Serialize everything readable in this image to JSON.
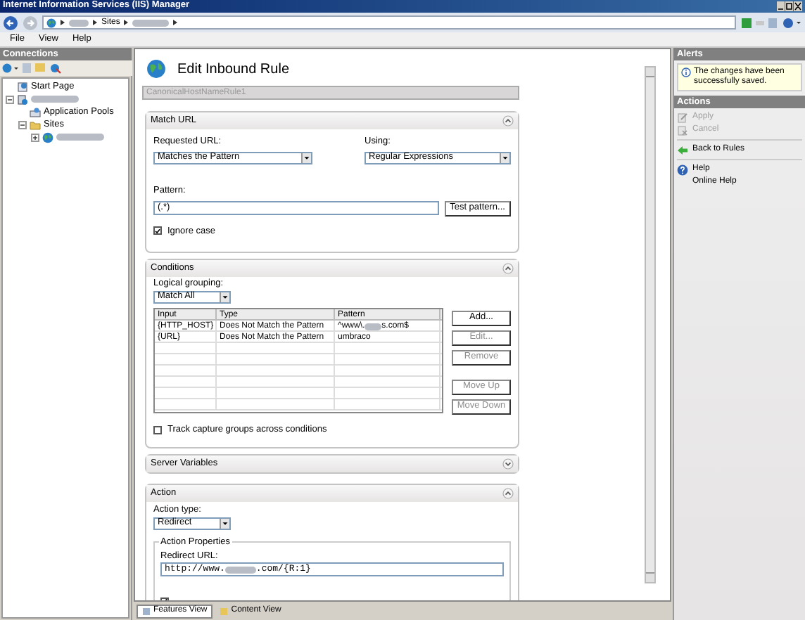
{
  "window": {
    "title": "Internet Information Services (IIS) Manager"
  },
  "breadcrumb": [
    {
      "redacted": true
    },
    {
      "redacted": false,
      "label": "Sites"
    },
    {
      "redacted": true
    }
  ],
  "menu": [
    "File",
    "View",
    "Help"
  ],
  "connections": {
    "title": "Connections",
    "tree": [
      {
        "kind": "page",
        "label": "Start Page",
        "redacted": false
      },
      {
        "kind": "server",
        "redacted": true,
        "expanded": true,
        "children": [
          {
            "kind": "pools",
            "label": "Application Pools",
            "redacted": false
          },
          {
            "kind": "folder",
            "label": "Sites",
            "redacted": false,
            "expanded": true,
            "children": [
              {
                "kind": "site",
                "redacted": true,
                "expanded": false
              }
            ]
          }
        ]
      }
    ]
  },
  "page": {
    "title": "Edit Inbound Rule",
    "name": "CanonicalHostNameRule1"
  },
  "match_url": {
    "title": "Match URL",
    "expanded": true,
    "requested_url_label": "Requested URL:",
    "requested_url": "Matches the Pattern",
    "using_label": "Using:",
    "using": "Regular Expressions",
    "pattern_label": "Pattern:",
    "pattern": "(.*)",
    "test_button": "Test pattern...",
    "ignore_case": {
      "label": "Ignore case",
      "checked": true
    }
  },
  "conditions": {
    "title": "Conditions",
    "expanded": true,
    "grouping_label": "Logical grouping:",
    "grouping": "Match All",
    "columns": [
      "Input",
      "Type",
      "Pattern"
    ],
    "rows": [
      {
        "input": "{HTTP_HOST}",
        "type": "Does Not Match the Pattern",
        "pattern": [
          "^www\\.",
          "s.com$"
        ]
      },
      {
        "input": "{URL}",
        "type": "Does Not Match the Pattern",
        "pattern": [
          "umbraco"
        ]
      }
    ],
    "button_groups": [
      [
        {
          "label": "Add...",
          "disabled": false
        },
        {
          "label": "Edit...",
          "disabled": true
        },
        {
          "label": "Remove",
          "disabled": true
        }
      ],
      [
        {
          "label": "Move Up",
          "disabled": true
        },
        {
          "label": "Move Down",
          "disabled": true
        }
      ]
    ],
    "track": {
      "label": "Track capture groups across conditions",
      "checked": false
    }
  },
  "server_variables": {
    "title": "Server Variables",
    "expanded": false
  },
  "action": {
    "title": "Action",
    "expanded": true,
    "action_type_label": "Action type:",
    "action_type": "Redirect",
    "properties_title": "Action Properties",
    "redirect_label": "Redirect URL:",
    "redirect_url": [
      "http://www.",
      ".com/{R:1}"
    ],
    "append": {
      "checked": true
    }
  },
  "view_tabs": [
    {
      "label": "Features View",
      "selected": true
    },
    {
      "label": "Content View",
      "selected": false
    }
  ],
  "alerts": {
    "title": "Alerts",
    "message": "The changes have been successfully saved."
  },
  "actions": {
    "title": "Actions",
    "items": [
      {
        "kind": "apply",
        "label": "Apply",
        "disabled": true
      },
      {
        "kind": "cancel",
        "label": "Cancel",
        "disabled": true
      },
      {
        "kind": "back",
        "label": "Back to Rules",
        "disabled": false
      },
      {
        "kind": "help",
        "label": "Help",
        "disabled": false
      },
      {
        "kind": "link",
        "label": "Online Help",
        "disabled": false
      }
    ]
  }
}
